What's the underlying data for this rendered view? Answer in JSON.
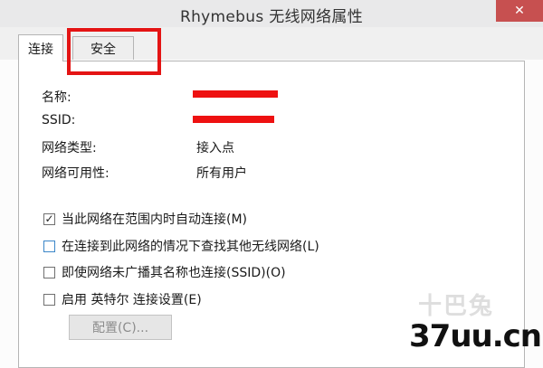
{
  "window": {
    "title": "Rhymebus 无线网络属性",
    "close_glyph": "✕"
  },
  "tabs": [
    {
      "label": "连接",
      "active": true
    },
    {
      "label": "安全",
      "active": false
    }
  ],
  "properties": [
    {
      "label": "名称:",
      "value": ""
    },
    {
      "label": "SSID:",
      "value": ""
    },
    {
      "label": "网络类型:",
      "value": "接入点"
    },
    {
      "label": "网络可用性:",
      "value": "所有用户"
    }
  ],
  "options": [
    {
      "label": "当此网络在范围内时自动连接(M)",
      "checked": true
    },
    {
      "label": "在连接到此网络的情况下查找其他无线网络(L)",
      "checked": false
    },
    {
      "label": "即使网络未广播其名称也连接(SSID)(O)",
      "checked": false
    },
    {
      "label": "启用 英特尔 连接设置(E)",
      "checked": false
    }
  ],
  "config_button": {
    "label": "配置(C)...",
    "enabled": false
  },
  "watermark": {
    "faint": "十巴兔",
    "main": "37uu.cn"
  },
  "colors": {
    "highlight_red": "#e41414",
    "redaction": "#ee1111",
    "close_bg": "#c75050"
  }
}
